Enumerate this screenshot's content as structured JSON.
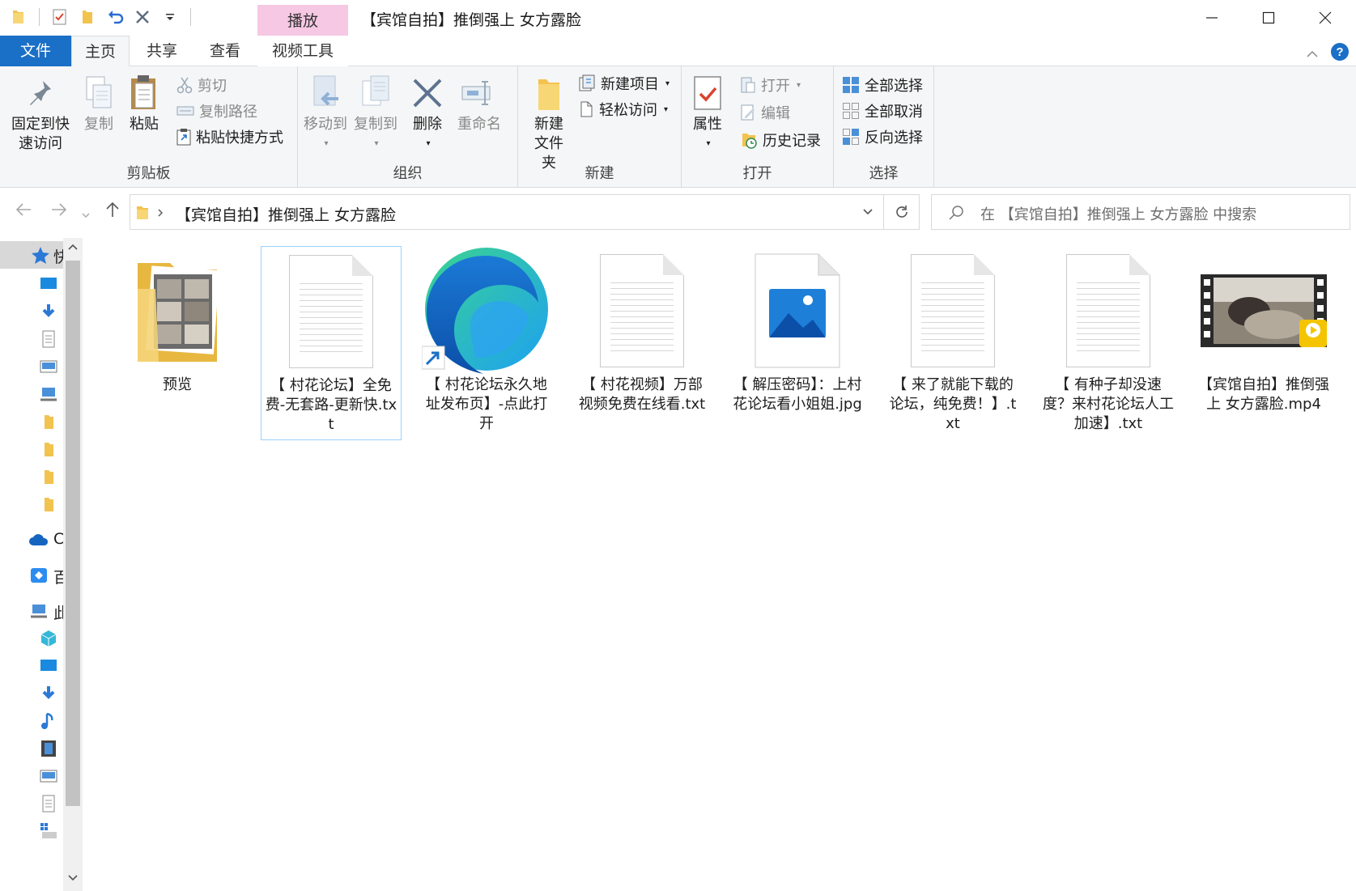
{
  "titlebar": {
    "contextual_tab": "播放",
    "title": "【宾馆自拍】推倒强上 女方露脸"
  },
  "tabs": {
    "file": "文件",
    "home": "主页",
    "share": "共享",
    "view": "查看",
    "video_tools": "视频工具"
  },
  "ribbon": {
    "clipboard": {
      "label": "剪贴板",
      "pin": "固定到快速访问",
      "copy": "复制",
      "paste": "粘贴",
      "cut": "剪切",
      "copy_path": "复制路径",
      "paste_shortcut": "粘贴快捷方式"
    },
    "organize": {
      "label": "组织",
      "move_to": "移动到",
      "copy_to": "复制到",
      "delete": "删除",
      "rename": "重命名"
    },
    "new": {
      "label": "新建",
      "new_folder": "新建文件夹",
      "new_item": "新建项目",
      "easy_access": "轻松访问"
    },
    "open": {
      "label": "打开",
      "properties": "属性",
      "open": "打开",
      "edit": "编辑",
      "history": "历史记录"
    },
    "select": {
      "label": "选择",
      "select_all": "全部选择",
      "select_none": "全部取消",
      "invert": "反向选择"
    }
  },
  "address": {
    "path": "【宾馆自拍】推倒强上 女方露脸",
    "search_placeholder": "在 【宾馆自拍】推倒强上 女方露脸 中搜索"
  },
  "nav": {
    "quick_access": "快",
    "onedrive": "C",
    "baidu": "百",
    "this_pc": "此"
  },
  "files": [
    {
      "name": "预览",
      "type": "folder"
    },
    {
      "name": "【 村花论坛】全免费-无套路-更新快.txt",
      "type": "txt",
      "selected": true
    },
    {
      "name": "【 村花论坛永久地址发布页】-点此打开",
      "type": "edge-shortcut"
    },
    {
      "name": "【 村花视频】万部视频免费在线看.txt",
      "type": "txt"
    },
    {
      "name": "【 解压密码】：上村花论坛看小姐姐.jpg",
      "type": "jpg"
    },
    {
      "name": "【 来了就能下载的论坛，纯免费！】.txt",
      "type": "txt"
    },
    {
      "name": "【 有种子却没速度？来村花论坛人工加速】.txt",
      "type": "txt"
    },
    {
      "name": "【宾馆自拍】推倒强上 女方露脸.mp4",
      "type": "mp4"
    }
  ],
  "colors": {
    "file_tab": "#1a6fc6",
    "contextual_tab": "#f6c8e4",
    "selection_border": "#99d1ff"
  }
}
